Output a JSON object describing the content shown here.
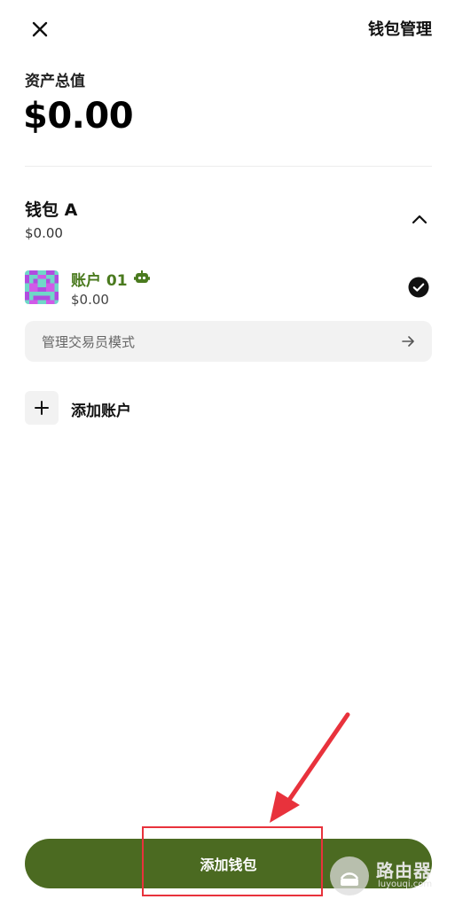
{
  "header": {
    "close_icon": "close-icon",
    "manage_label": "钱包管理"
  },
  "total": {
    "label": "资产总值",
    "value": "$0.00"
  },
  "wallet": {
    "name": "钱包 A",
    "value": "$0.00",
    "expanded": true,
    "collapse_icon": "chevron-up-icon"
  },
  "account": {
    "name": "账户 01",
    "value": "$0.00",
    "badge_icon": "bot-icon",
    "selected": true,
    "selected_icon": "check-circle-icon"
  },
  "trader_mode": {
    "label": "管理交易员模式",
    "icon": "arrow-right-icon"
  },
  "add_account": {
    "label": "添加账户",
    "icon": "plus-icon"
  },
  "add_wallet": {
    "label": "添加钱包"
  },
  "watermark": {
    "text": "路由器",
    "sub": "luyouqi.com"
  },
  "colors": {
    "accent": "#4b6a21",
    "account_name": "#4a7a1e",
    "annotation": "#e8323c"
  }
}
